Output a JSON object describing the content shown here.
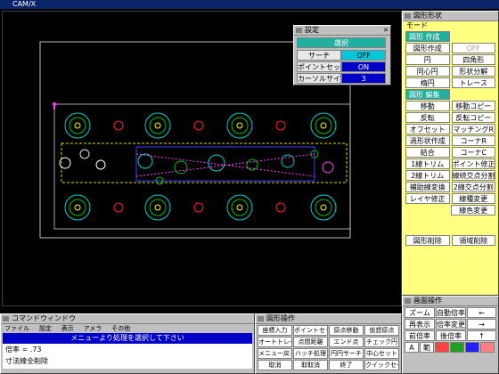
{
  "app": {
    "title": "CAM/X"
  },
  "setting_popup": {
    "title": "設定",
    "header": "選択",
    "rows": [
      {
        "label": "サーチ",
        "value": "OFF"
      },
      {
        "label": "ポイントセット",
        "value": "ON"
      },
      {
        "label": "カーソルサイズ",
        "value": "3"
      }
    ]
  },
  "right_panel": {
    "title": "図形形状",
    "mode_label": "モード",
    "section1": "図形 作成",
    "grid1": [
      [
        "図形作成",
        "OFF"
      ],
      [
        "円",
        "四角形"
      ],
      [
        "同心円",
        "形状分解"
      ],
      [
        "楕円",
        "トレース"
      ]
    ],
    "section2": "図形 編集",
    "grid2": [
      [
        "移動",
        "移動コピー"
      ],
      [
        "反転",
        "反転コピー"
      ],
      [
        "オフセット",
        "マッチングR"
      ],
      [
        "渦形状作成",
        "コーナR"
      ],
      [
        "結合",
        "コーナC"
      ],
      [
        "1線トリム",
        "ポイント修正"
      ],
      [
        "2線トリム",
        "線続交点分割"
      ],
      [
        "補助線変換",
        "2線交点分割"
      ],
      [
        "レイヤ修正",
        "線種変更"
      ],
      [
        "",
        "線色変更"
      ]
    ],
    "bottom_buttons": [
      "図形削除",
      "領域削除"
    ]
  },
  "display_panel": {
    "title": "画面操作",
    "rows": [
      [
        "ズーム",
        "自動倍率",
        "←"
      ],
      [
        "再表示",
        "倍率変更",
        "→"
      ],
      [
        "前倍率",
        "後倍率",
        "↑"
      ],
      [
        "A",
        "範",
        "",
        "",
        "",
        ""
      ]
    ]
  },
  "command_window": {
    "title": "コマンドウィンドウ",
    "menus": [
      "ファイル",
      "設定",
      "表示",
      "アメラ",
      "その他"
    ],
    "prompt": "メニューより処理を選択して下さい",
    "line1": "倍率 =      .73",
    "line2": "寸法線全削除"
  },
  "ops_panel": {
    "title": "図形操作",
    "rows": [
      [
        "座標入力",
        "ポイントセット",
        "原点移動",
        "仮想原点"
      ],
      [
        "オートトレース",
        "点間距離",
        "エンド点",
        "チェック円"
      ],
      [
        "メニュー戻る",
        "ハッチ処理",
        "円円サーチ",
        "中心セット"
      ],
      [
        "取消",
        "取取消",
        "終了",
        "クイックセーブ"
      ]
    ]
  },
  "colors": {
    "accent": "#00c8d8",
    "title": "#0a246a",
    "prompt": "#0000c8"
  }
}
